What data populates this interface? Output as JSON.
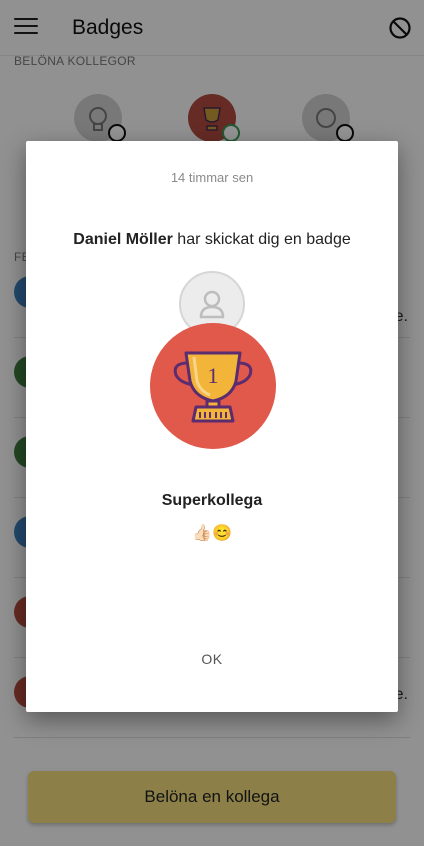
{
  "appbar": {
    "title": "Badges"
  },
  "reward_section": {
    "label": "BELÖNA KOLLEGOR"
  },
  "feed_section": {
    "label": "FE"
  },
  "feed_rows": [
    {
      "suffix": "e."
    },
    {
      "suffix": ""
    },
    {
      "suffix": ""
    },
    {
      "suffix": ""
    },
    {
      "suffix": ""
    },
    {
      "suffix": "e."
    }
  ],
  "primary_button": {
    "label": "Belöna en kollega"
  },
  "dialog": {
    "timestamp": "14 timmar sen",
    "sender": "Daniel Möller",
    "message": " har skickat dig en badge",
    "badge_name": "Superkollega",
    "badge_comment": "👍🏻😊",
    "trophy_number": "1",
    "ok_label": "OK"
  },
  "colors": {
    "badge_red": "#e0594a",
    "button_yellow": "#f2dd7d",
    "trophy_gold": "#f3b43a",
    "trophy_outline": "#5b2c6f"
  }
}
